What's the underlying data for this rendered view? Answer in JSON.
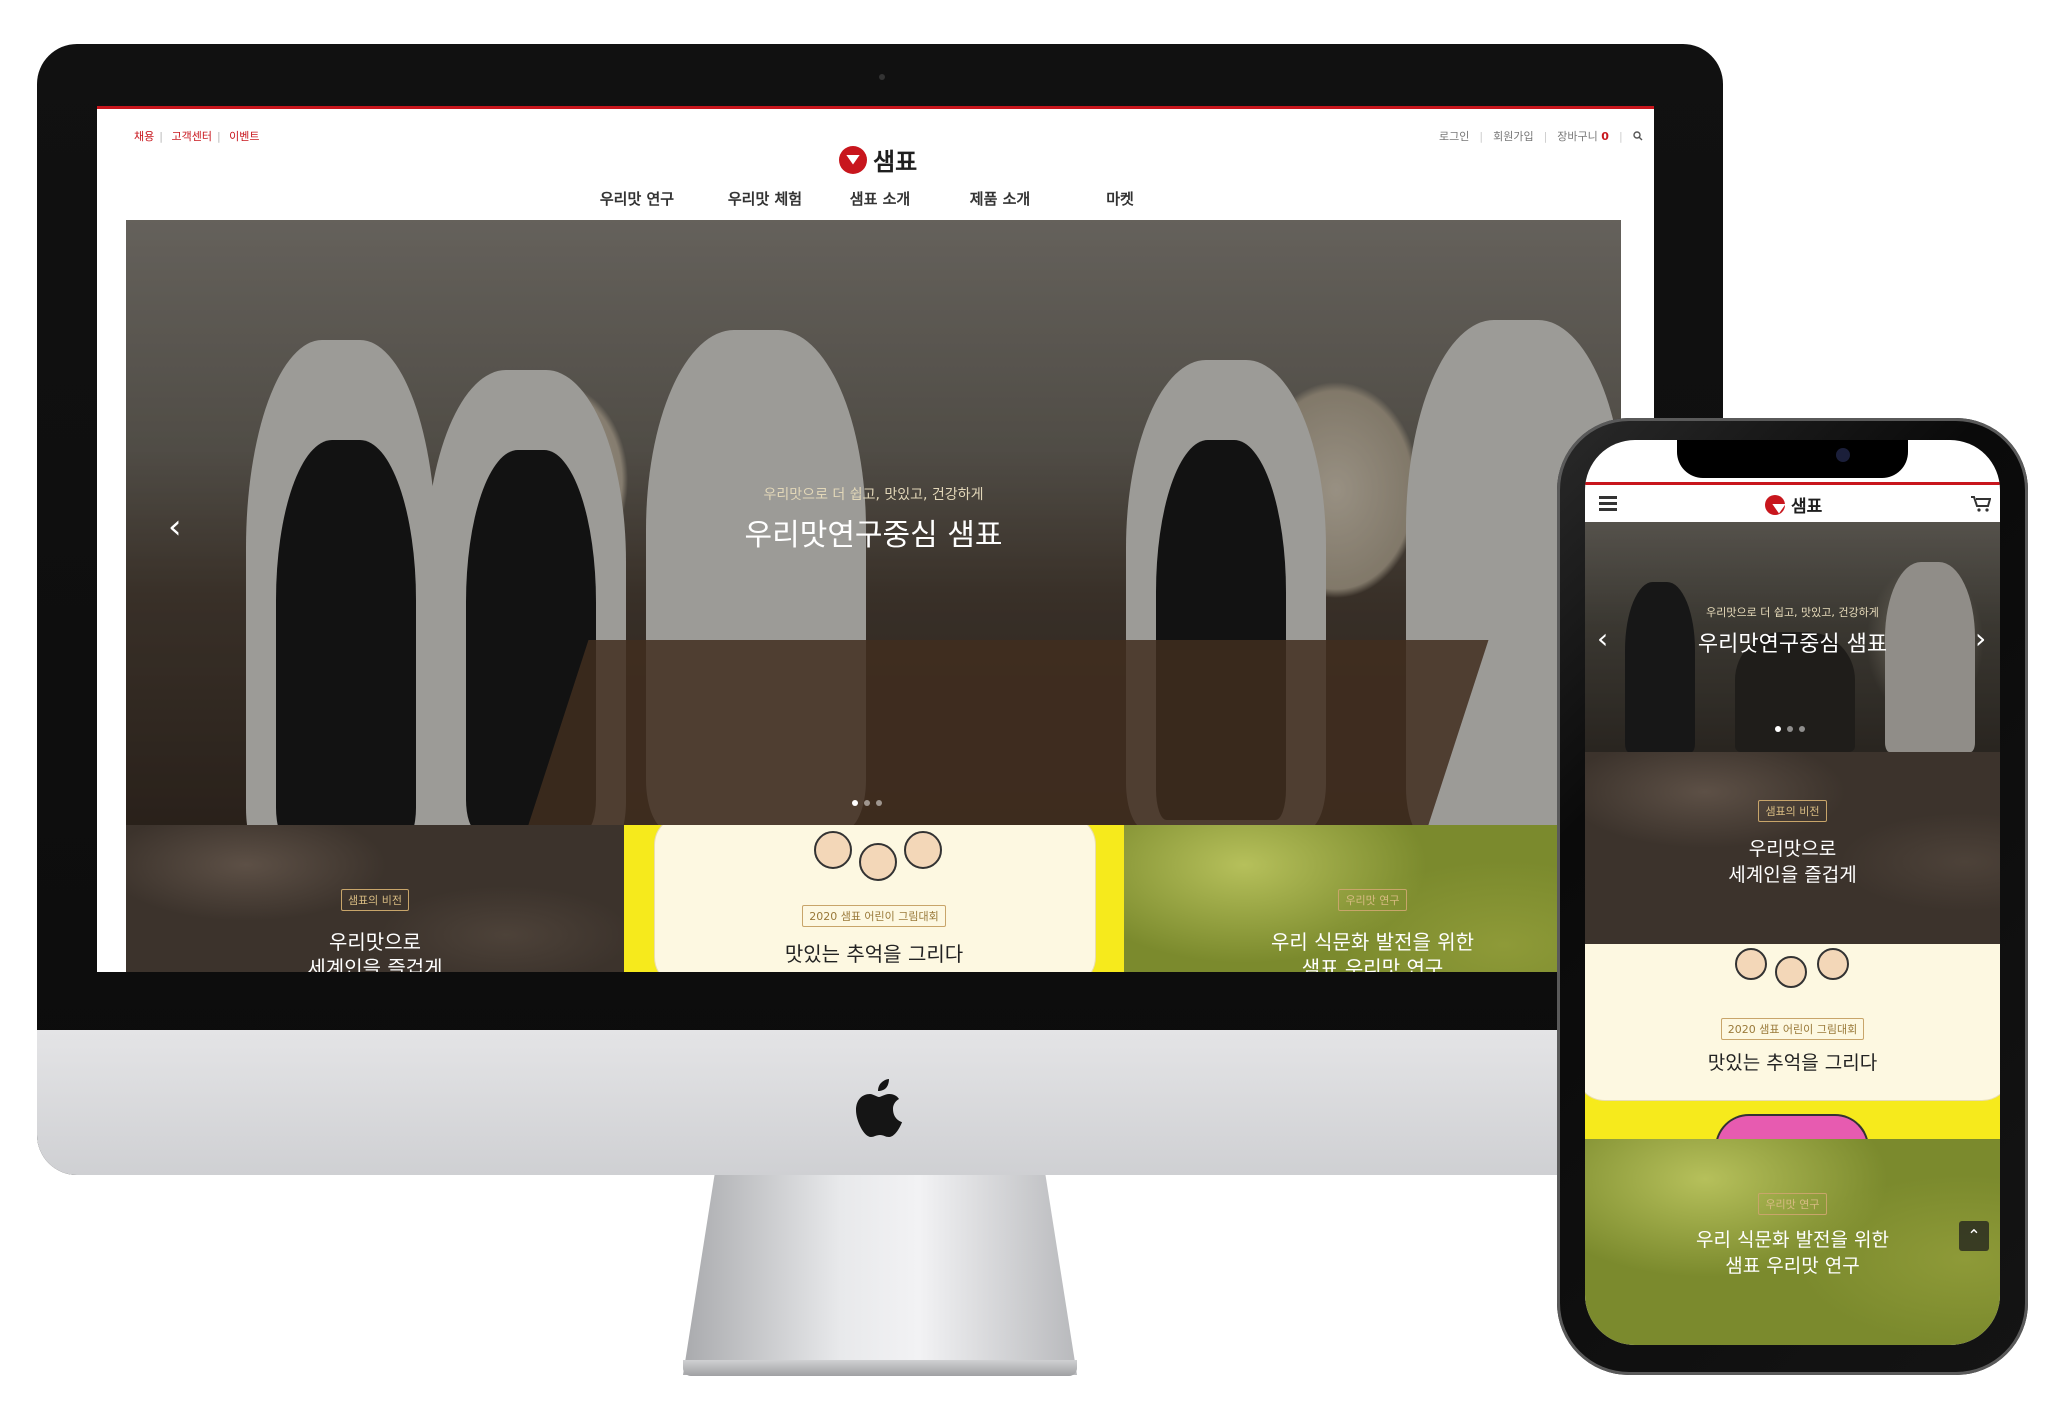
{
  "desktop": {
    "util_links": [
      "채용",
      "고객센터",
      "이벤트"
    ],
    "user_links": [
      "로그인",
      "회원가입",
      "장바구니"
    ],
    "cart_count": "0",
    "logo_text": "샘표",
    "nav": [
      "우리맛 연구",
      "우리맛 체험",
      "샘표 소개",
      "제품 소개",
      "마켓"
    ],
    "hero": {
      "subtitle": "우리맛으로 더 쉽고, 맛있고, 건강하게",
      "title": "우리맛연구중심 샘표",
      "prev": "‹",
      "next": "›"
    },
    "panels": [
      {
        "badge": "샘표의 비전",
        "title": "우리맛으로\n세계인을 즐겁게"
      },
      {
        "badge": "2020 샘표 어린이 그림대회",
        "title": "맛있는 추억을 그리다"
      },
      {
        "badge": "우리맛 연구",
        "title": "우리 식문화 발전을 위한\n샘표 우리맛 연구"
      }
    ]
  },
  "mobile": {
    "logo_text": "샘표",
    "menu_icon": "hamburger-icon",
    "cart_icon": "cart-icon",
    "hero": {
      "subtitle": "우리맛으로 더 쉽고, 맛있고, 건강하게",
      "title": "우리맛연구중심 샘표",
      "prev": "‹",
      "next": "›"
    },
    "sections": [
      {
        "badge": "샘표의 비전",
        "title_line1": "우리맛으로",
        "title_line2": "세계인을 즐겁게"
      },
      {
        "badge": "2020 샘표 어린이 그림대회",
        "title": "맛있는 추억을 그리다"
      },
      {
        "badge": "우리맛 연구",
        "title_line1": "우리 식문화 발전을 위한",
        "title_line2": "샘표 우리맛 연구"
      }
    ],
    "top_button": "⌃"
  },
  "colors": {
    "brand_red": "#c8161d",
    "badge_gold": "#d7bb82",
    "panel_yellow": "#f6ea1c"
  }
}
